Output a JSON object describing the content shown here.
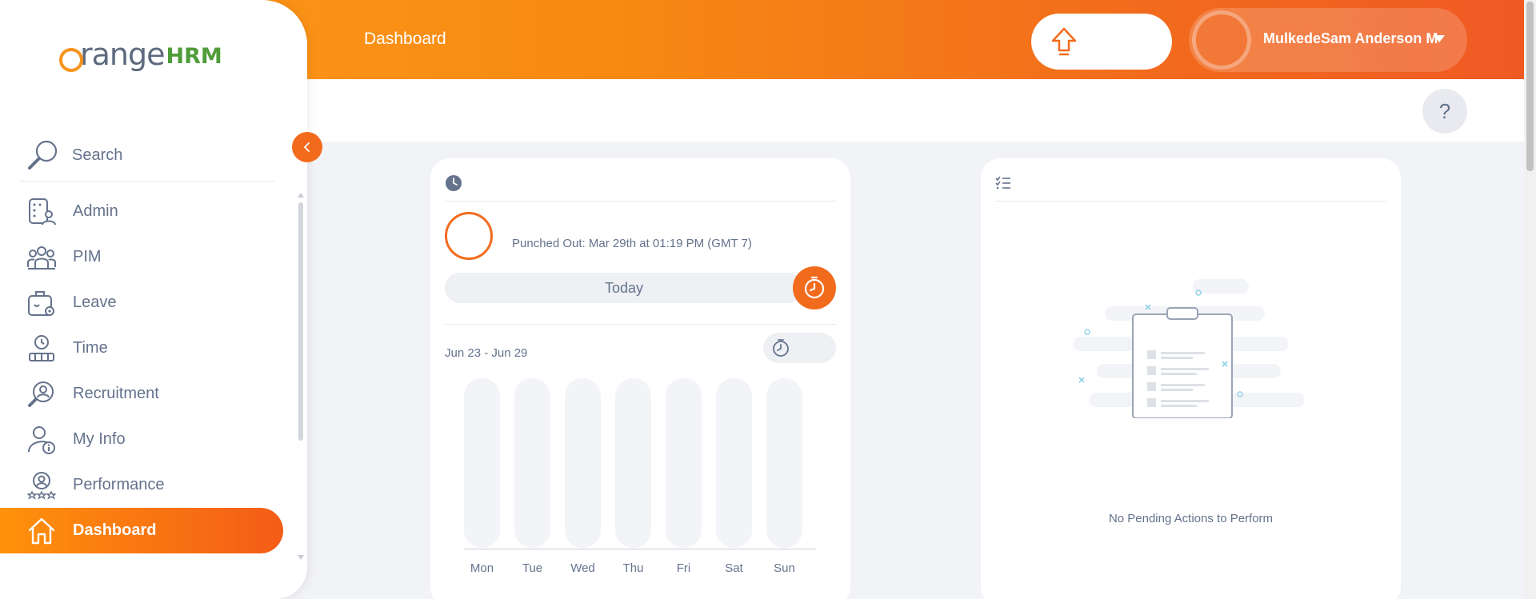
{
  "header": {
    "page_title": "Dashboard",
    "user_name": "MulkedeSam Anderson M"
  },
  "sidebar": {
    "logo_main": "range",
    "logo_hrm": "HRM",
    "search_placeholder": "Search",
    "items": [
      {
        "label": "Admin",
        "icon": "admin-icon"
      },
      {
        "label": "PIM",
        "icon": "pim-icon"
      },
      {
        "label": "Leave",
        "icon": "leave-icon"
      },
      {
        "label": "Time",
        "icon": "time-icon"
      },
      {
        "label": "Recruitment",
        "icon": "recruitment-icon"
      },
      {
        "label": "My Info",
        "icon": "my-info-icon"
      },
      {
        "label": "Performance",
        "icon": "performance-icon"
      },
      {
        "label": "Dashboard",
        "icon": "home-icon"
      }
    ],
    "active_item": "Dashboard"
  },
  "help": {
    "label": "?"
  },
  "time_card": {
    "punch_status": "Punched Out: Mar 29th at 01:19 PM (GMT 7)",
    "today_label": "Today",
    "week_range": "Jun 23 - Jun 29",
    "days": [
      "Mon",
      "Tue",
      "Wed",
      "Thu",
      "Fri",
      "Sat",
      "Sun"
    ]
  },
  "actions_card": {
    "empty_message": "No Pending Actions to Perform"
  },
  "colors": {
    "accent": "#f26b1d",
    "accent_light": "#ff920b",
    "text": "#64728c",
    "background": "#f2f3f7"
  }
}
